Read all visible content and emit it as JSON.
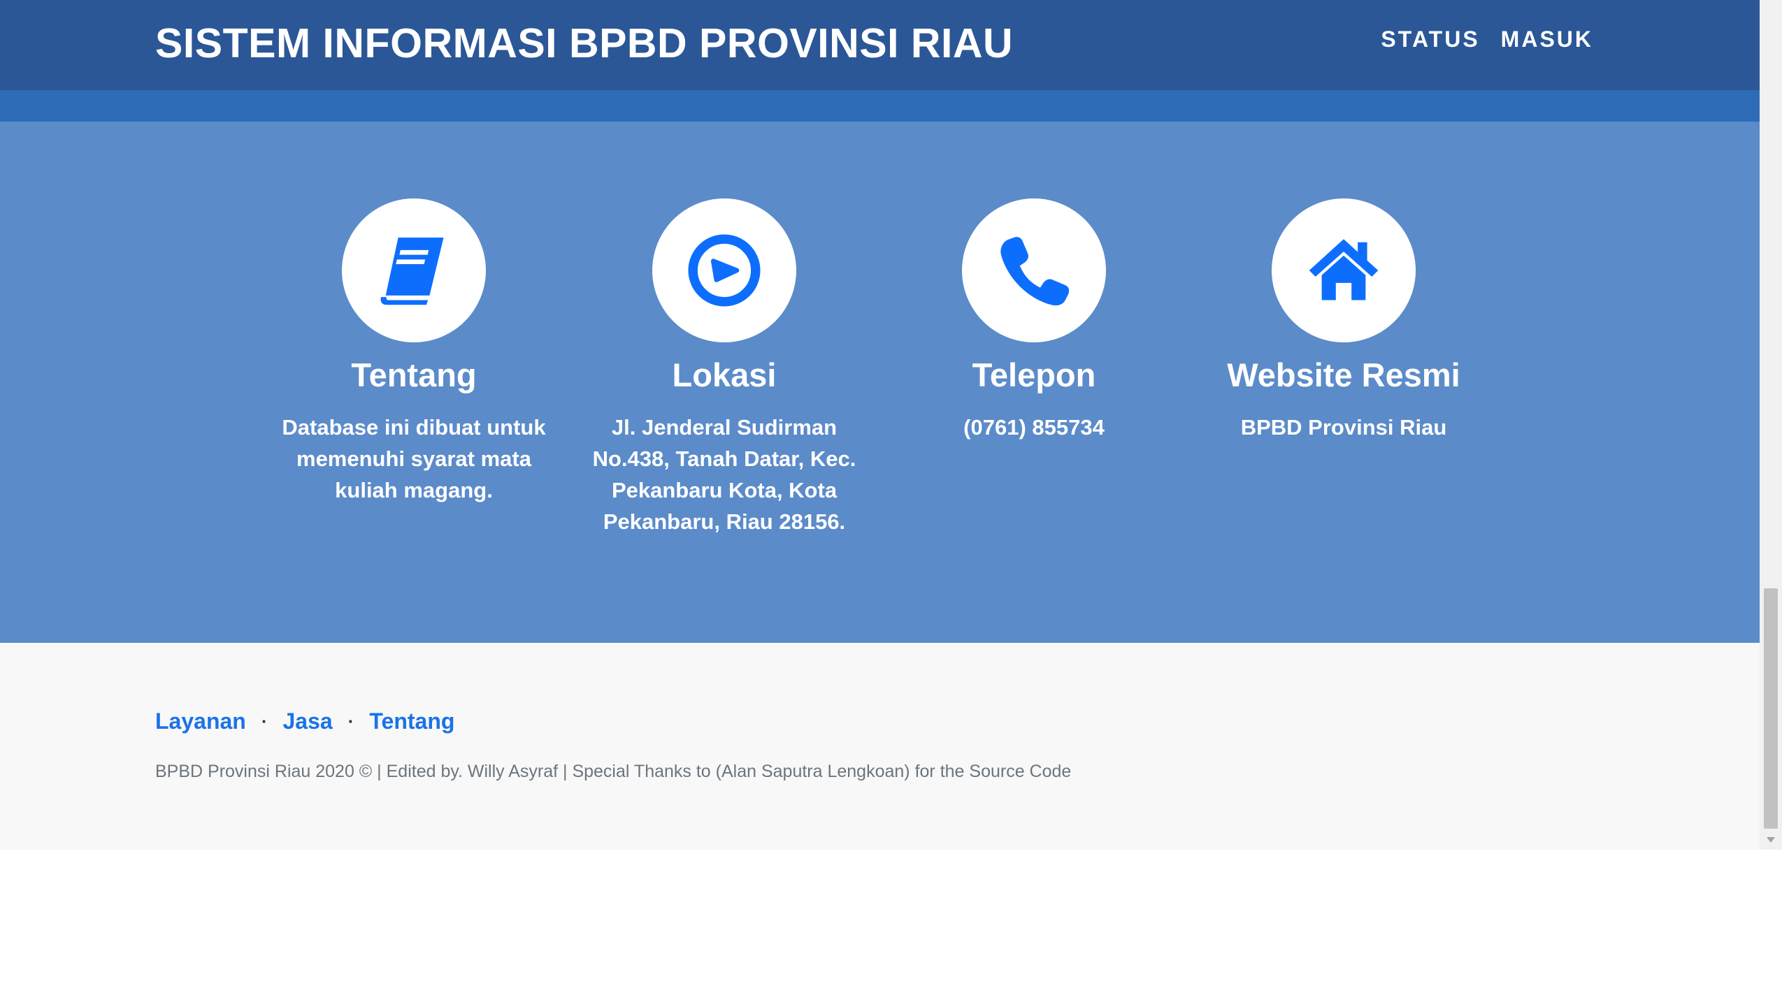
{
  "header": {
    "title": "SISTEM INFORMASI BPBD PROVINSI RIAU",
    "nav": [
      {
        "label": "STATUS"
      },
      {
        "label": "MASUK"
      }
    ]
  },
  "contact": {
    "items": [
      {
        "icon": "book-icon",
        "title": "Tentang",
        "text": "Database ini dibuat untuk memenuhi syarat mata kuliah magang."
      },
      {
        "icon": "location-icon",
        "title": "Lokasi",
        "text": "Jl. Jenderal Sudirman No.438, Tanah Datar, Kec. Pekanbaru Kota, Kota Pekanbaru, Riau 28156."
      },
      {
        "icon": "phone-icon",
        "title": "Telepon",
        "text": "(0761) 855734"
      },
      {
        "icon": "home-icon",
        "title": "Website Resmi",
        "text": "BPBD Provinsi Riau"
      }
    ]
  },
  "footer": {
    "links": [
      {
        "label": "Layanan"
      },
      {
        "label": "Jasa"
      },
      {
        "label": "Tentang"
      }
    ],
    "separator": "·",
    "copyright": "BPBD Provinsi Riau 2020 © | Edited by. Willy Asyraf | Special Thanks to (Alan Saputra Lengkoan) for the Source Code"
  },
  "colors": {
    "navbar": "#2b5797",
    "stripe": "#2f6cb7",
    "contact_bg": "#5b8bc9",
    "icon_blue": "#0d6efd",
    "link_blue": "#1a73e8",
    "footer_bg": "#f8f8f8"
  }
}
